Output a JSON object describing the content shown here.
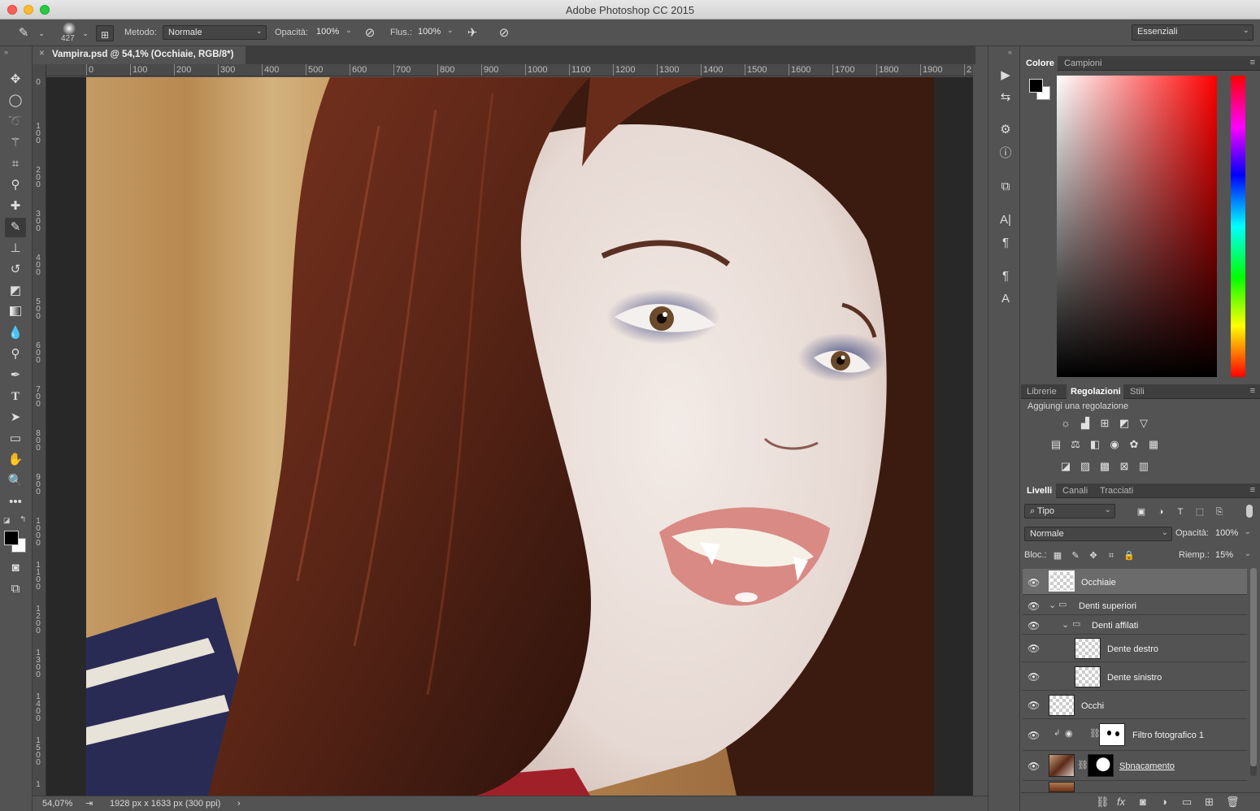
{
  "window": {
    "title": "Adobe Photoshop CC 2015"
  },
  "options": {
    "brush_size": "427",
    "method_label": "Metodo:",
    "method_value": "Normale",
    "opacity_label": "Opacità:",
    "opacity_value": "100%",
    "flow_label": "Flus.:",
    "flow_value": "100%",
    "workspace": "Essenziali"
  },
  "document_tab": {
    "title": "Vampira.psd @ 54,1% (Occhiaie, RGB/8*)"
  },
  "ruler": {
    "h": [
      "0",
      "100",
      "200",
      "300",
      "400",
      "500",
      "600",
      "700",
      "800",
      "900",
      "1000",
      "1100",
      "1200",
      "1300",
      "1400",
      "1500",
      "1600",
      "1700",
      "1800",
      "1900",
      "2"
    ],
    "v": [
      "0",
      "100",
      "200",
      "300",
      "400",
      "500",
      "600",
      "700",
      "800",
      "900",
      "1000",
      "1100",
      "1200",
      "1300",
      "1400",
      "1500",
      "1"
    ]
  },
  "status": {
    "zoom": "54,07%",
    "doc_info": "1928 px x 1633 px (300 ppi)"
  },
  "color_panel": {
    "tabs": [
      "Colore",
      "Campioni"
    ]
  },
  "adjust_panel": {
    "tabs": [
      "Librerie",
      "Regolazioni",
      "Stili"
    ],
    "heading": "Aggiungi una regolazione"
  },
  "layers_panel": {
    "tabs": [
      "Livelli",
      "Canali",
      "Tracciati"
    ],
    "filter": "Tipo",
    "blend_mode": "Normale",
    "opacity_label": "Opacità:",
    "opacity_value": "100%",
    "lock_label": "Bloc.:",
    "fill_label": "Riemp.:",
    "fill_value": "15%",
    "layers": [
      {
        "name": "Occhiaie"
      },
      {
        "name": "Denti superiori"
      },
      {
        "name": "Denti affilati"
      },
      {
        "name": "Dente destro"
      },
      {
        "name": "Dente sinistro"
      },
      {
        "name": "Occhi"
      },
      {
        "name": "Filtro fotografico 1"
      },
      {
        "name": "Sbnacamento"
      }
    ]
  },
  "colors": {
    "accent": "#535353",
    "dark": "#282828",
    "selected_layer": "#6b6b6b"
  }
}
